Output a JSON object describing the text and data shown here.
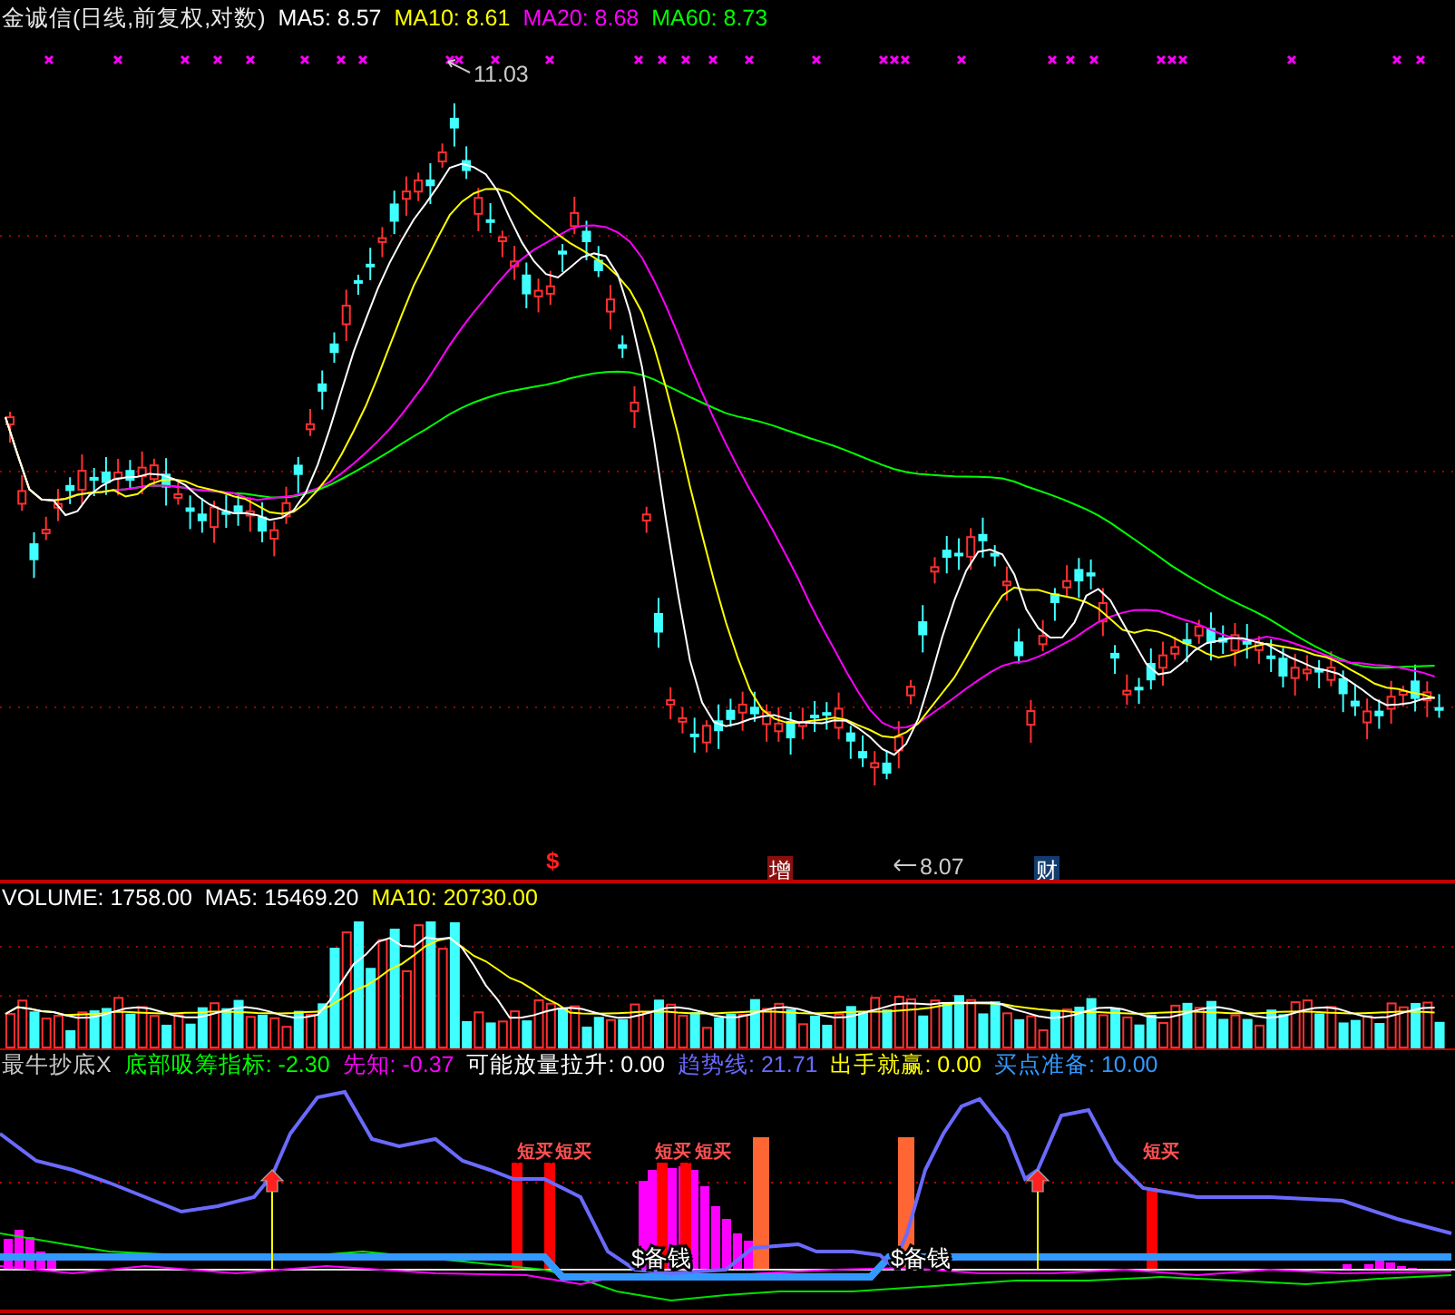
{
  "title": {
    "text": "金诚信(日线,前复权,对数)"
  },
  "price_legend": [
    {
      "label": "MA5:",
      "value": "8.57",
      "color": "#ffffff"
    },
    {
      "label": "MA10:",
      "value": "8.61",
      "color": "#ffff00"
    },
    {
      "label": "MA20:",
      "value": "8.68",
      "color": "#ff00ff"
    },
    {
      "label": "MA60:",
      "value": "8.73",
      "color": "#00ff00"
    }
  ],
  "price_chart": {
    "high_label": "11.03",
    "low_label": "8.07",
    "events": [
      {
        "text": "$",
        "kind": "plain",
        "color": "#ff2020"
      },
      {
        "text": "增",
        "kind": "tag",
        "color": "#8a1010"
      },
      {
        "text": "财",
        "kind": "tag",
        "color": "#123c6e"
      }
    ]
  },
  "volume_legend": [
    {
      "label": "VOLUME:",
      "value": "1758.00",
      "color": "#ffffff"
    },
    {
      "label": "MA5:",
      "value": "15469.20",
      "color": "#ffffff"
    },
    {
      "label": "MA10:",
      "value": "20730.00",
      "color": "#ffff00"
    }
  ],
  "indicator": {
    "name": "最牛抄底X",
    "legend": [
      {
        "label": "底部吸筹指标:",
        "value": "-2.30",
        "color": "#00ff00"
      },
      {
        "label": "先知:",
        "value": "-0.37",
        "color": "#ff00ff"
      },
      {
        "label": "可能放量拉升:",
        "value": "0.00",
        "color": "#ffffff"
      },
      {
        "label": "趋势线:",
        "value": "21.71",
        "color": "#6a6aff"
      },
      {
        "label": "出手就赢:",
        "value": "0.00",
        "color": "#ffff00"
      },
      {
        "label": "买点准备:",
        "value": "10.00",
        "color": "#3399ff"
      }
    ],
    "signals": [
      {
        "text": "短买",
        "kind": "buy"
      },
      {
        "text": "短买",
        "kind": "buy"
      },
      {
        "text": "短买",
        "kind": "buy"
      },
      {
        "text": "短买",
        "kind": "buy"
      },
      {
        "text": "短买",
        "kind": "buy"
      },
      {
        "text": "$备钱",
        "kind": "prepare"
      },
      {
        "text": "$备钱",
        "kind": "prepare"
      }
    ]
  }
}
